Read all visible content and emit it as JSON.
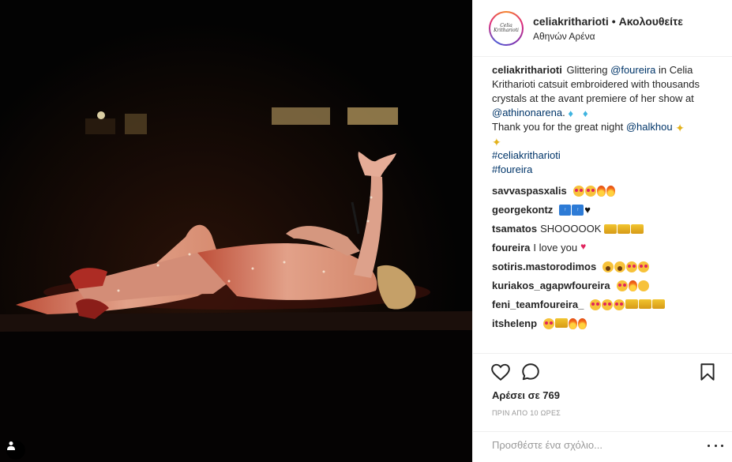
{
  "post": {
    "username": "celiakritharioti",
    "separator": "•",
    "follow_status": "Ακολουθείτε",
    "location": "Αθηνών Αρένα",
    "avatar_text": "Celia Kritharioti"
  },
  "caption": {
    "username": "celiakritharioti",
    "text1": "Glittering ",
    "mention1": "@foureira",
    "text2": " in Celia Kritharioti catsuit embroidered with thousands crystals at the avant premiere of her show at ",
    "mention2": "@athinonarena",
    "text3": ".",
    "line2_text": "Thank you for the great night ",
    "mention3": "@halkhou",
    "hashtag1": "#celiakritharioti",
    "hashtag2": "#foureira"
  },
  "comments": [
    {
      "user": "savvaspasxalis",
      "text": "",
      "emoji": [
        "heart-eyes",
        "heart-eyes",
        "fire",
        "fire"
      ]
    },
    {
      "user": "georgekontz",
      "text": "",
      "emoji": [
        "top",
        "top",
        "heart"
      ]
    },
    {
      "user": "tsamatos",
      "text": "SHOOOOOK",
      "emoji": [
        "crown",
        "crown",
        "crown"
      ]
    },
    {
      "user": "foureira",
      "text": "I love you",
      "emoji": [
        "red-heart"
      ]
    },
    {
      "user": "sotiris.mastorodimos",
      "text": "",
      "emoji": [
        "scream",
        "scream",
        "heart-eyes",
        "heart-eyes"
      ]
    },
    {
      "user": "kuriakos_agapwfoureira",
      "text": "",
      "emoji": [
        "heart-eyes",
        "fire",
        "wink"
      ]
    },
    {
      "user": "feni_teamfoureira_",
      "text": "",
      "emoji": [
        "heart-eyes",
        "heart-eyes",
        "heart-eyes",
        "crown",
        "crown",
        "crown"
      ]
    },
    {
      "user": "itshelenp",
      "text": "",
      "emoji": [
        "heart-eyes",
        "crown",
        "fire",
        "fire"
      ]
    }
  ],
  "actions": {
    "likes": "Αρέσει σε 769",
    "time": "ΠΡΙΝ ΑΠΟ 10 ΩΡΕΣ",
    "comment_placeholder": "Προσθέστε ένα σχόλιο..."
  },
  "icons": {
    "like": "heart-outline-icon",
    "comment": "speech-bubble-icon",
    "save": "bookmark-icon",
    "user_tag": "person-icon",
    "more": "ellipsis-icon"
  },
  "colors": {
    "link": "#003569",
    "muted": "#999999",
    "text": "#262626",
    "border": "#efefef"
  }
}
